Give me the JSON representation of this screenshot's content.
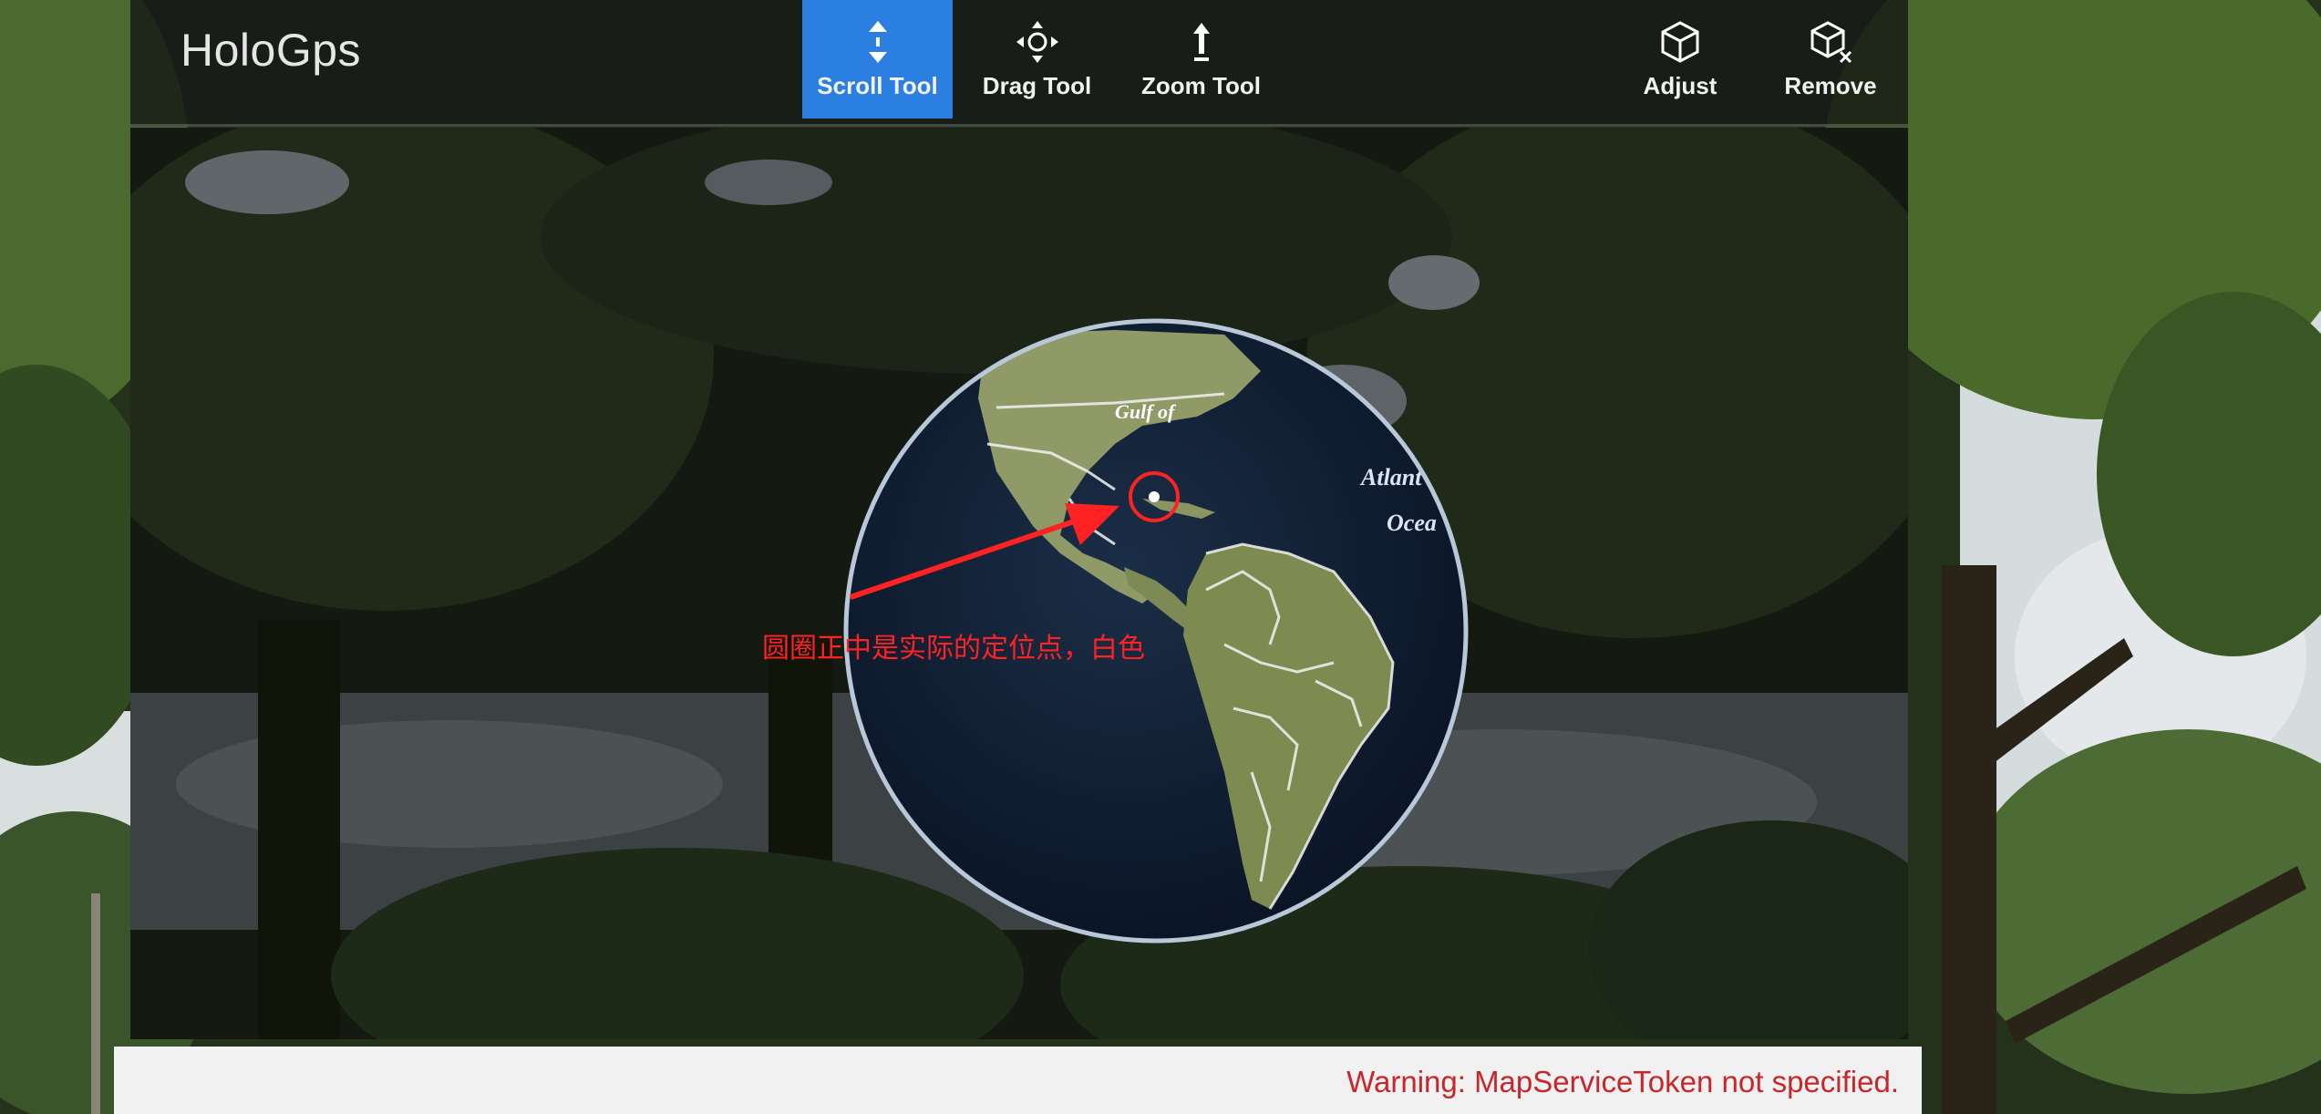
{
  "app": {
    "title": "HoloGps"
  },
  "toolbar": {
    "tools": [
      {
        "label": "Scroll Tool",
        "icon": "scroll-arrows-icon",
        "active": true
      },
      {
        "label": "Drag Tool",
        "icon": "move-arrows-icon",
        "active": false
      },
      {
        "label": "Zoom Tool",
        "icon": "zoom-arrow-icon",
        "active": false
      }
    ],
    "actions": [
      {
        "label": "Adjust",
        "icon": "cube-icon"
      },
      {
        "label": "Remove",
        "icon": "cube-remove-icon"
      }
    ]
  },
  "map": {
    "labels": {
      "gulf": "Gulf of",
      "atlantic": "Atlant",
      "ocean": "Ocea"
    }
  },
  "annotation": {
    "text": "圆圈正中是实际的定位点，白色",
    "color": "#ff2222"
  },
  "status": {
    "warning": "Warning: MapServiceToken not specified."
  },
  "colors": {
    "accent": "#2b7fe0",
    "warning": "#c8262a",
    "annotation": "#ff2222"
  }
}
